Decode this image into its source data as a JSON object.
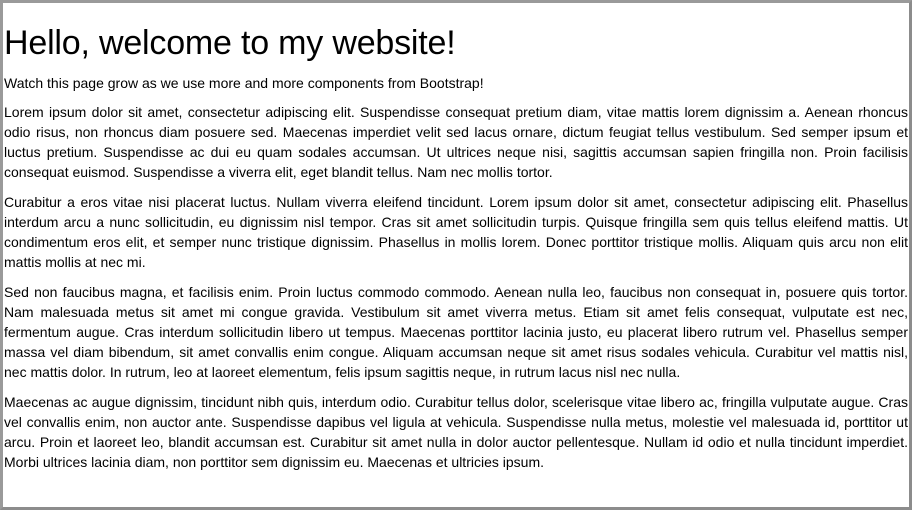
{
  "page": {
    "title": "Hello, welcome to my website!",
    "lead": "Watch this page grow as we use more and more components from Bootstrap!",
    "paragraphs": [
      "Lorem ipsum dolor sit amet, consectetur adipiscing elit. Suspendisse consequat pretium diam, vitae mattis lorem dignissim a. Aenean rhoncus odio risus, non rhoncus diam posuere sed. Maecenas imperdiet velit sed lacus ornare, dictum feugiat tellus vestibulum. Sed semper ipsum et luctus pretium. Suspendisse ac dui eu quam sodales accumsan. Ut ultrices neque nisi, sagittis accumsan sapien fringilla non. Proin facilisis consequat euismod. Suspendisse a viverra elit, eget blandit tellus. Nam nec mollis tortor.",
      "Curabitur a eros vitae nisi placerat luctus. Nullam viverra eleifend tincidunt. Lorem ipsum dolor sit amet, consectetur adipiscing elit. Phasellus interdum arcu a nunc sollicitudin, eu dignissim nisl tempor. Cras sit amet sollicitudin turpis. Quisque fringilla sem quis tellus eleifend mattis. Ut condimentum eros elit, et semper nunc tristique dignissim. Phasellus in mollis lorem. Donec porttitor tristique mollis. Aliquam quis arcu non elit mattis mollis at nec mi.",
      "Sed non faucibus magna, et facilisis enim. Proin luctus commodo commodo. Aenean nulla leo, faucibus non consequat in, posuere quis tortor. Nam malesuada metus sit amet mi congue gravida. Vestibulum sit amet viverra metus. Etiam sit amet felis consequat, vulputate est nec, fermentum augue. Cras interdum sollicitudin libero ut tempus. Maecenas porttitor lacinia justo, eu placerat libero rutrum vel. Phasellus semper massa vel diam bibendum, sit amet convallis enim congue. Aliquam accumsan neque sit amet risus sodales vehicula. Curabitur vel mattis nisl, nec mattis dolor. In rutrum, leo at laoreet elementum, felis ipsum sagittis neque, in rutrum lacus nisl nec nulla.",
      "Maecenas ac augue dignissim, tincidunt nibh quis, interdum odio. Curabitur tellus dolor, scelerisque vitae libero ac, fringilla vulputate augue. Cras vel convallis enim, non auctor ante. Suspendisse dapibus vel ligula at vehicula. Suspendisse nulla metus, molestie vel malesuada id, porttitor ut arcu. Proin et laoreet leo, blandit accumsan est. Curabitur sit amet nulla in dolor auctor pellentesque. Nullam id odio et nulla tincidunt imperdiet. Morbi ultrices lacinia diam, non porttitor sem dignissim eu. Maecenas et ultricies ipsum."
    ]
  },
  "colors": {
    "page_background": "#ffffff",
    "text": "#000000",
    "frame_border": "#9a9a9a"
  }
}
